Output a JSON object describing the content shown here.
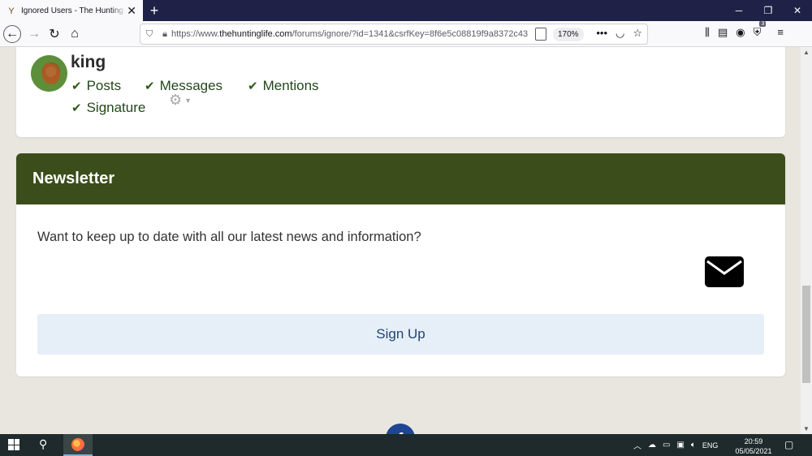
{
  "browser": {
    "tab_title": "Ignored Users - The Hunting Life",
    "url_prefix": "https://www.",
    "url_host": "thehuntinglife.com",
    "url_rest": "/forums/ignore/?id=1341&csrfKey=8f6e5c08819f9a8372c43",
    "zoom": "170%",
    "addon_badge": "3"
  },
  "ignored_user": {
    "username": "king",
    "options": [
      "Posts",
      "Messages",
      "Mentions",
      "Signature"
    ]
  },
  "newsletter": {
    "heading": "Newsletter",
    "text": "Want to keep up to date with all our latest news and information?",
    "signup_label": "Sign Up"
  },
  "taskbar": {
    "language": "ENG",
    "time": "20:59",
    "date": "05/05/2021"
  },
  "colors": {
    "header_green": "#3b4d1b",
    "check_green": "#2e5a17",
    "signup_bg": "#e6eff8",
    "signup_text": "#21456e"
  }
}
